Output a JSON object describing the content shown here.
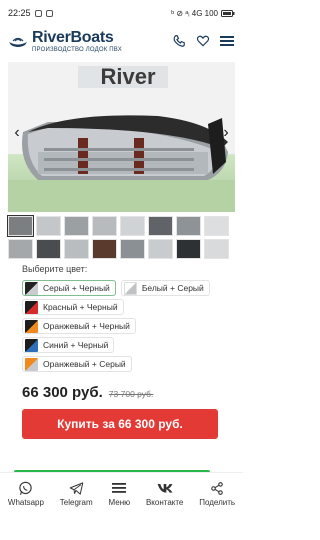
{
  "status": {
    "time": "22:25",
    "right_text": "ᵇ ⊘ ᵃᵢ 4G 100"
  },
  "header": {
    "brand": "RiverBoats",
    "subtitle": "ПРОИЗВОДСТВО ЛОДОК ПВХ",
    "icons": [
      "phone-icon",
      "heart-icon",
      "menu-icon"
    ]
  },
  "hero": {
    "prev_icon": "‹",
    "next_icon": "›",
    "boat_text": "River"
  },
  "color_picker": {
    "title": "Выберите цвет:",
    "options": [
      {
        "label": "Серый + Черный",
        "c1": "#222222",
        "c2": "#c8ccd0",
        "selected": true
      },
      {
        "label": "Белый + Серый",
        "c1": "#ffffff",
        "c2": "#bfc3c6",
        "selected": false
      },
      {
        "label": "Красный + Черный",
        "c1": "#1d1d1d",
        "c2": "#d62b2b",
        "selected": false
      },
      {
        "label": "Оранжевый + Черный",
        "c1": "#1d1d1d",
        "c2": "#f08a1c",
        "selected": false
      },
      {
        "label": "Синий + Черный",
        "c1": "#1d1d1d",
        "c2": "#2d6fb8",
        "selected": false
      },
      {
        "label": "Оранжевый + Серый",
        "c1": "#f08a1c",
        "c2": "#c6cace",
        "selected": false
      }
    ]
  },
  "pricing": {
    "price": "66 300 руб.",
    "old_price": "73 700 руб.",
    "buy_label": "Купить за 66 300 руб."
  },
  "bottom_nav": [
    {
      "label": "Whatsapp",
      "icon": "whatsapp-icon"
    },
    {
      "label": "Telegram",
      "icon": "telegram-icon"
    },
    {
      "label": "Меню",
      "icon": "menu-icon"
    },
    {
      "label": "Вконтакте",
      "icon": "vk-icon"
    },
    {
      "label": "Поделить",
      "icon": "share-icon"
    }
  ],
  "colors": {
    "brand_dark": "#1a3b5c",
    "buy_red": "#e33a36",
    "accent_green": "#26b84b"
  }
}
